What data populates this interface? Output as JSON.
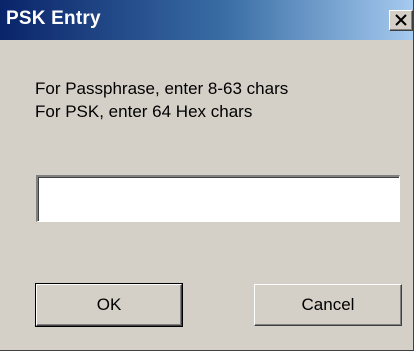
{
  "window": {
    "title": "PSK Entry",
    "close_icon": "close-x-icon"
  },
  "instructions": {
    "line1": "For Passphrase, enter 8-63 chars",
    "line2": "For PSK, enter 64 Hex chars"
  },
  "psk_input": {
    "value": "",
    "placeholder": ""
  },
  "buttons": {
    "ok_label": "OK",
    "cancel_label": "Cancel"
  },
  "colors": {
    "titlebar_start": "#0a246a",
    "titlebar_end": "#a6caf0",
    "dialog_face": "#d4d0c8"
  }
}
